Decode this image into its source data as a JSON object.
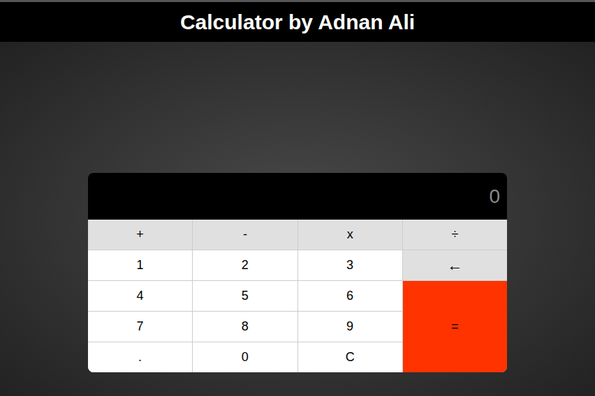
{
  "header": {
    "title": "Calculator by Adnan Ali"
  },
  "calculator": {
    "display": "0",
    "keys": [
      {
        "label": "+",
        "kind": "operator"
      },
      {
        "label": "-",
        "kind": "operator"
      },
      {
        "label": "x",
        "kind": "operator"
      },
      {
        "label": "÷",
        "kind": "operator"
      },
      {
        "label": "1",
        "kind": "digit"
      },
      {
        "label": "2",
        "kind": "digit"
      },
      {
        "label": "3",
        "kind": "digit"
      },
      {
        "label": "←",
        "kind": "back"
      },
      {
        "label": "4",
        "kind": "digit"
      },
      {
        "label": "5",
        "kind": "digit"
      },
      {
        "label": "6",
        "kind": "digit"
      },
      {
        "label": "=",
        "kind": "equals"
      },
      {
        "label": "7",
        "kind": "digit"
      },
      {
        "label": "8",
        "kind": "digit"
      },
      {
        "label": "9",
        "kind": "digit"
      },
      {
        "label": ".",
        "kind": "digit"
      },
      {
        "label": "0",
        "kind": "digit"
      },
      {
        "label": "C",
        "kind": "digit"
      }
    ]
  }
}
